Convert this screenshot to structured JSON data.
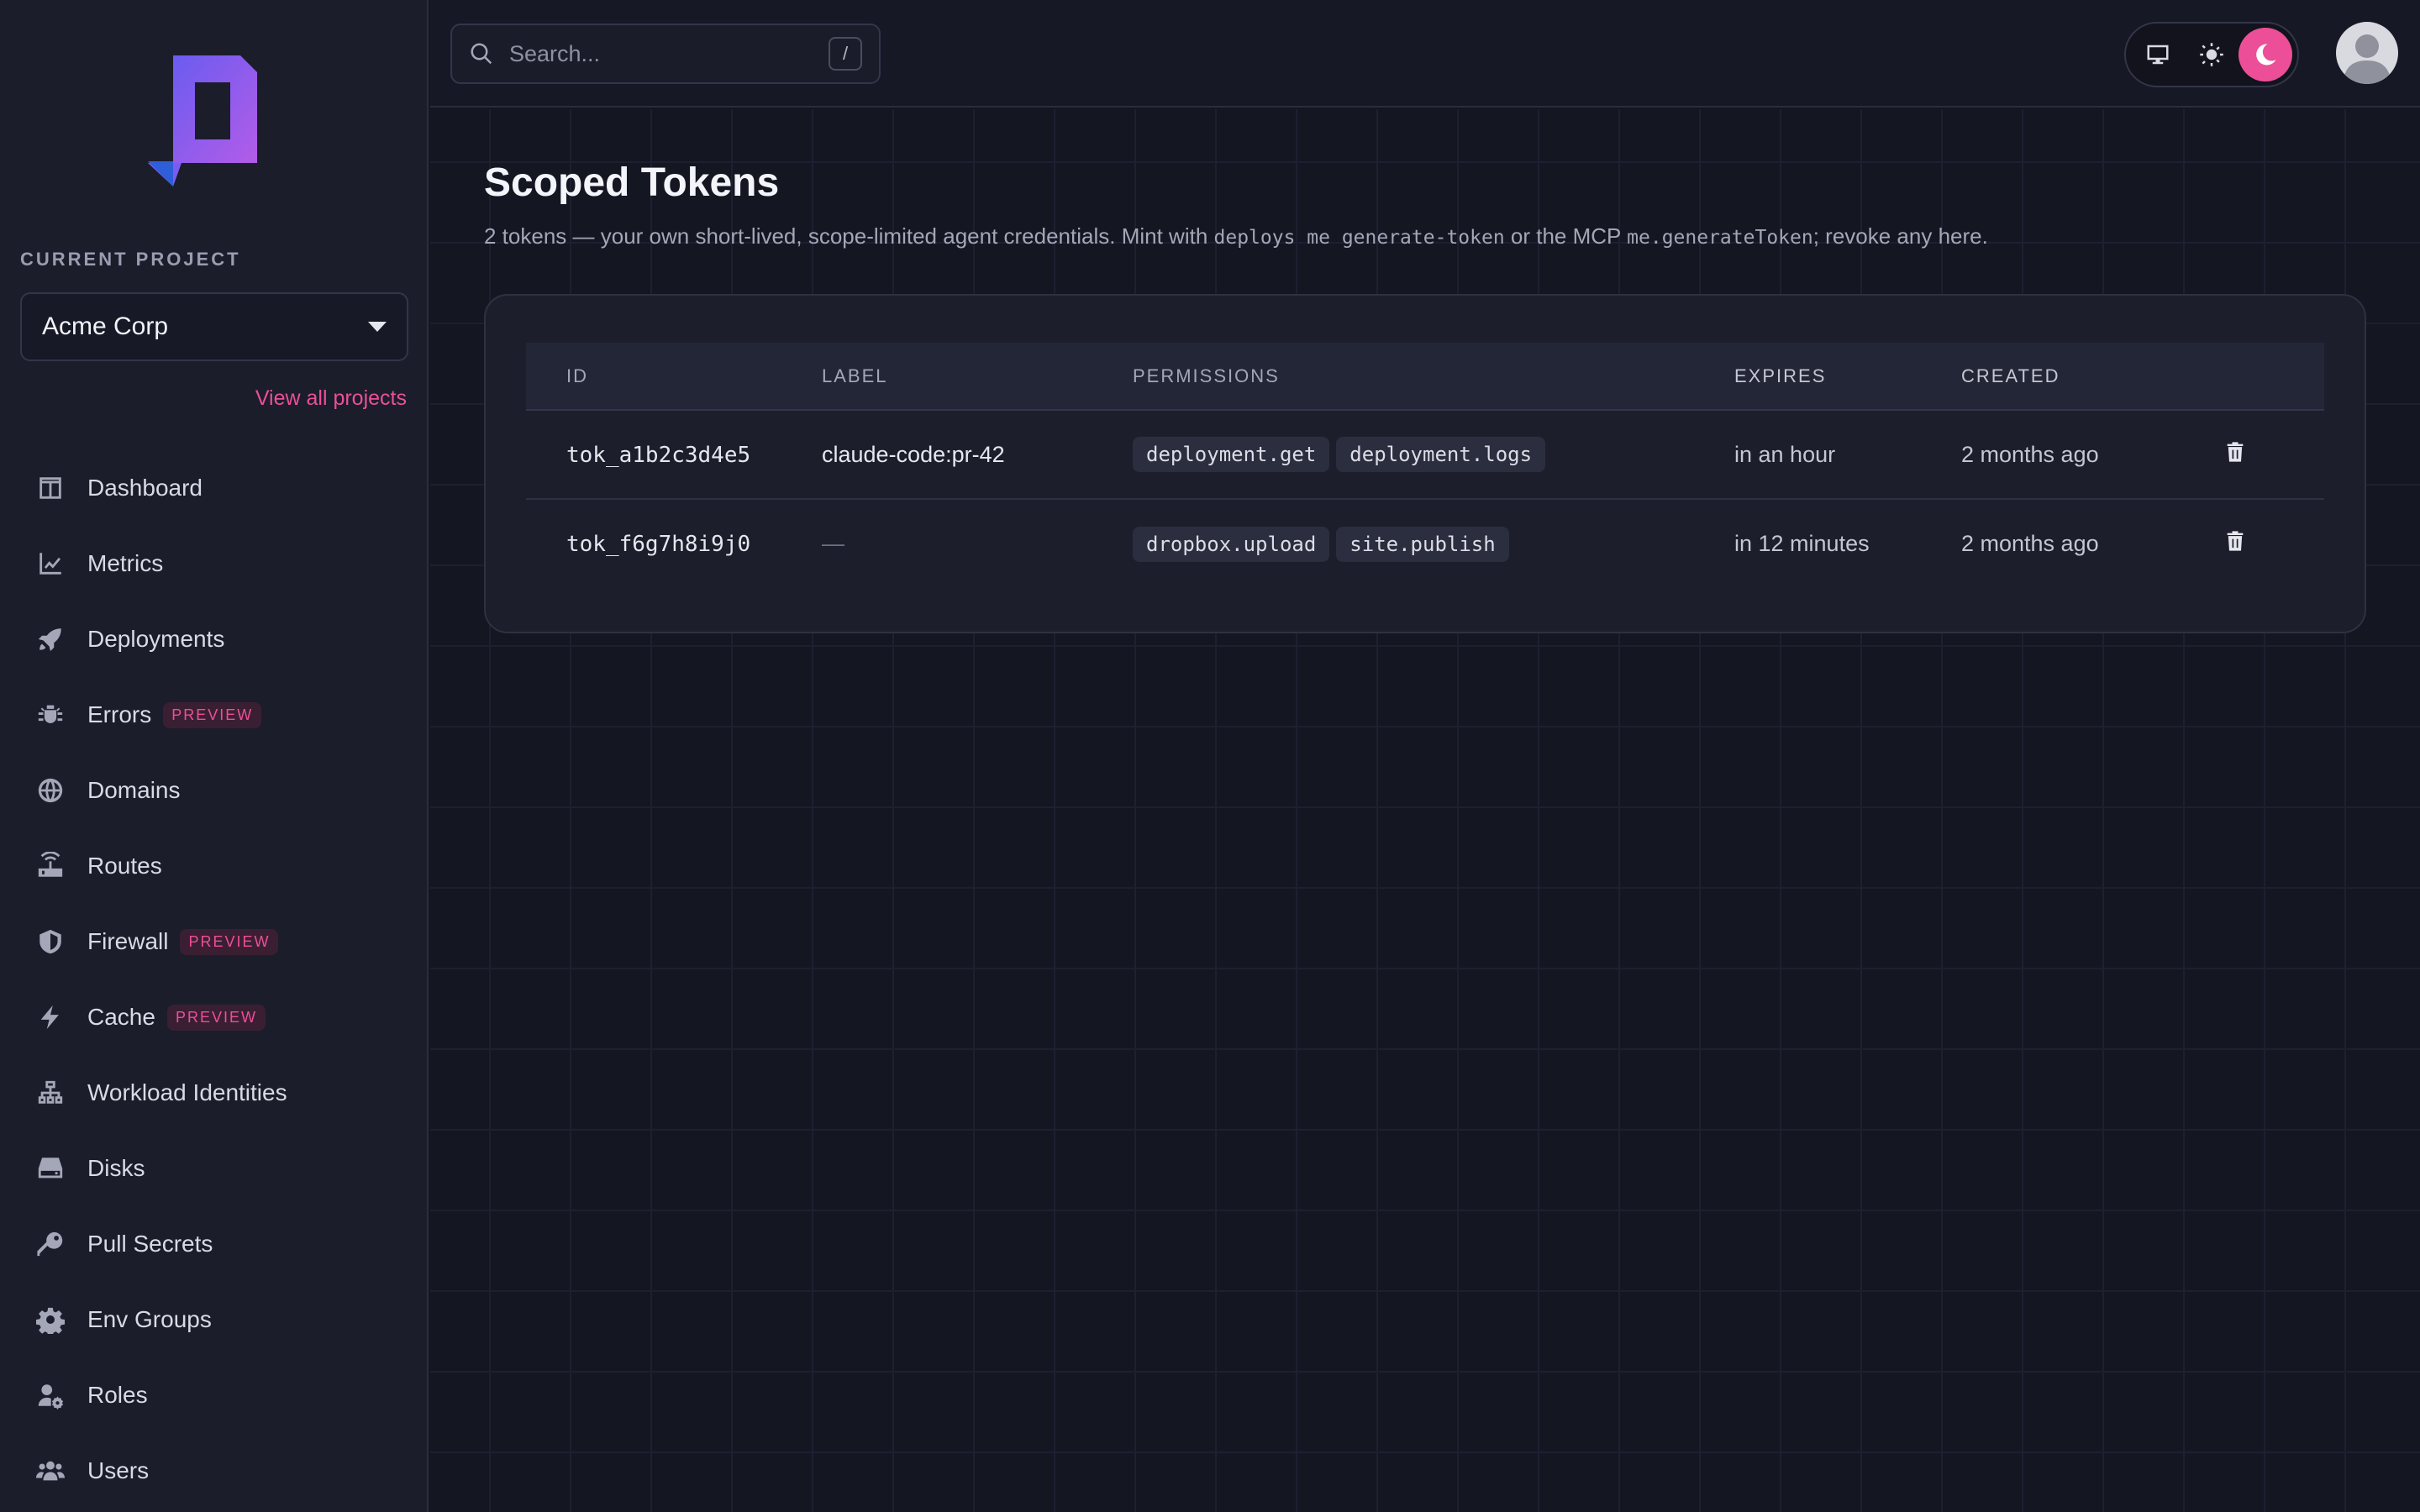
{
  "sidebar": {
    "section_label": "CURRENT PROJECT",
    "project": "Acme Corp",
    "view_all": "View all projects",
    "items": [
      {
        "label": "Dashboard",
        "icon": "dashboard-icon"
      },
      {
        "label": "Metrics",
        "icon": "chart-line-icon"
      },
      {
        "label": "Deployments",
        "icon": "rocket-icon"
      },
      {
        "label": "Errors",
        "icon": "bug-icon",
        "badge": "PREVIEW"
      },
      {
        "label": "Domains",
        "icon": "globe-icon"
      },
      {
        "label": "Routes",
        "icon": "router-icon"
      },
      {
        "label": "Firewall",
        "icon": "shield-icon",
        "badge": "PREVIEW"
      },
      {
        "label": "Cache",
        "icon": "bolt-icon",
        "badge": "PREVIEW"
      },
      {
        "label": "Workload Identities",
        "icon": "network-icon"
      },
      {
        "label": "Disks",
        "icon": "hard-drive-icon"
      },
      {
        "label": "Pull Secrets",
        "icon": "key-icon"
      },
      {
        "label": "Env Groups",
        "icon": "gear-icon"
      },
      {
        "label": "Roles",
        "icon": "user-gear-icon"
      },
      {
        "label": "Users",
        "icon": "users-icon"
      }
    ]
  },
  "topbar": {
    "search_placeholder": "Search...",
    "search_shortcut": "/",
    "theme_options": [
      "desktop-icon",
      "sun-icon",
      "moon-icon"
    ],
    "theme_active": "moon-icon"
  },
  "page": {
    "title": "Scoped Tokens",
    "subtitle_1": "2 tokens — your own short-lived, scope-limited agent credentials. Mint with ",
    "subtitle_code_1": "deploys me generate-token",
    "subtitle_2": " or the MCP ",
    "subtitle_code_2": "me.generateToken",
    "subtitle_3": "; revoke any here."
  },
  "table": {
    "headers": {
      "id": "ID",
      "label": "LABEL",
      "permissions": "PERMISSIONS",
      "expires": "EXPIRES",
      "created": "CREATED"
    },
    "rows": [
      {
        "id": "tok_a1b2c3d4e5",
        "label": "claude-code:pr-42",
        "permissions": [
          "deployment.get",
          "deployment.logs"
        ],
        "expires": "in an hour",
        "created": "2 months ago"
      },
      {
        "id": "tok_f6g7h8i9j0",
        "label": "—",
        "permissions": [
          "dropbox.upload",
          "site.publish"
        ],
        "expires": "in 12 minutes",
        "created": "2 months ago"
      }
    ]
  },
  "colors": {
    "accent": "#ec4f97",
    "background": "#141622",
    "sidebar": "#1b1d2b"
  }
}
